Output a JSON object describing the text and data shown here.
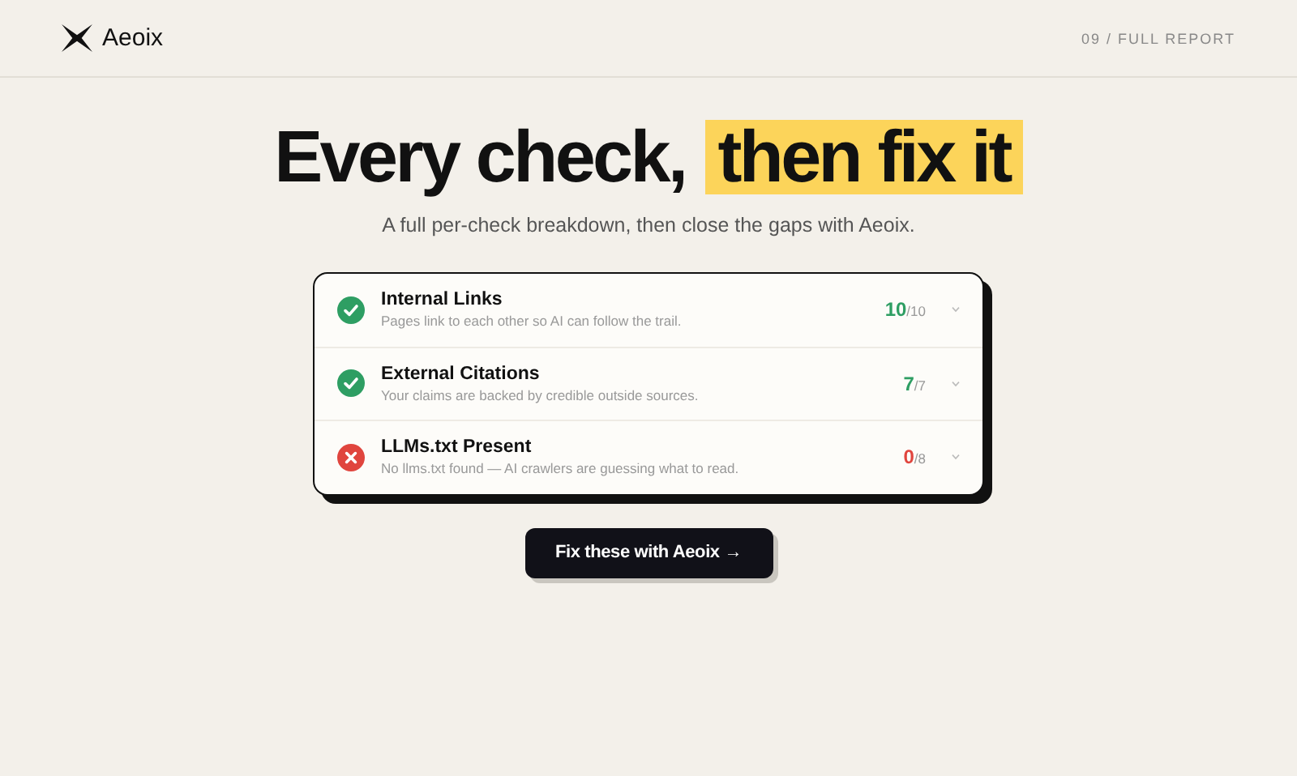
{
  "brand": {
    "name": "Aeoix"
  },
  "page_label": "09 / FULL REPORT",
  "headline": {
    "lead": "Every check,",
    "highlight": "then fix it"
  },
  "subtitle": "A full per-check breakdown, then close the gaps with Aeoix.",
  "checks": [
    {
      "kind": "pass",
      "title": "Internal Links",
      "description": "Pages link to each other so AI can follow the trail.",
      "score": "10",
      "total": "/10"
    },
    {
      "kind": "pass",
      "title": "External Citations",
      "description": "Your claims are backed by credible outside sources.",
      "score": "7",
      "total": "/7"
    },
    {
      "kind": "fail",
      "title": "LLMs.txt Present",
      "description": "No llms.txt found — AI crawlers are guessing what to read.",
      "score": "0",
      "total": "/8"
    }
  ],
  "cta": "Fix these with Aeoix →"
}
